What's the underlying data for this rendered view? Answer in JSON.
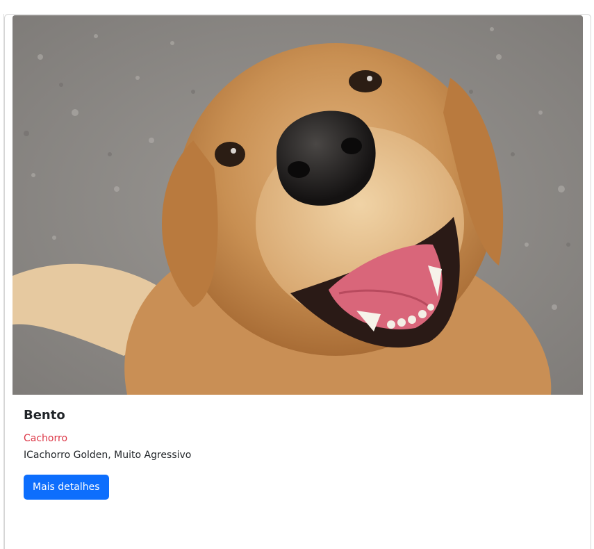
{
  "card": {
    "image_alt": "golden retriever",
    "title": "Bento",
    "subtitle": "Cachorro",
    "description": "ICachorro Golden, Muito Agressivo",
    "button_label": "Mais detalhes"
  },
  "colors": {
    "subtitle": "#dc3545",
    "button": "#0d6efd"
  }
}
